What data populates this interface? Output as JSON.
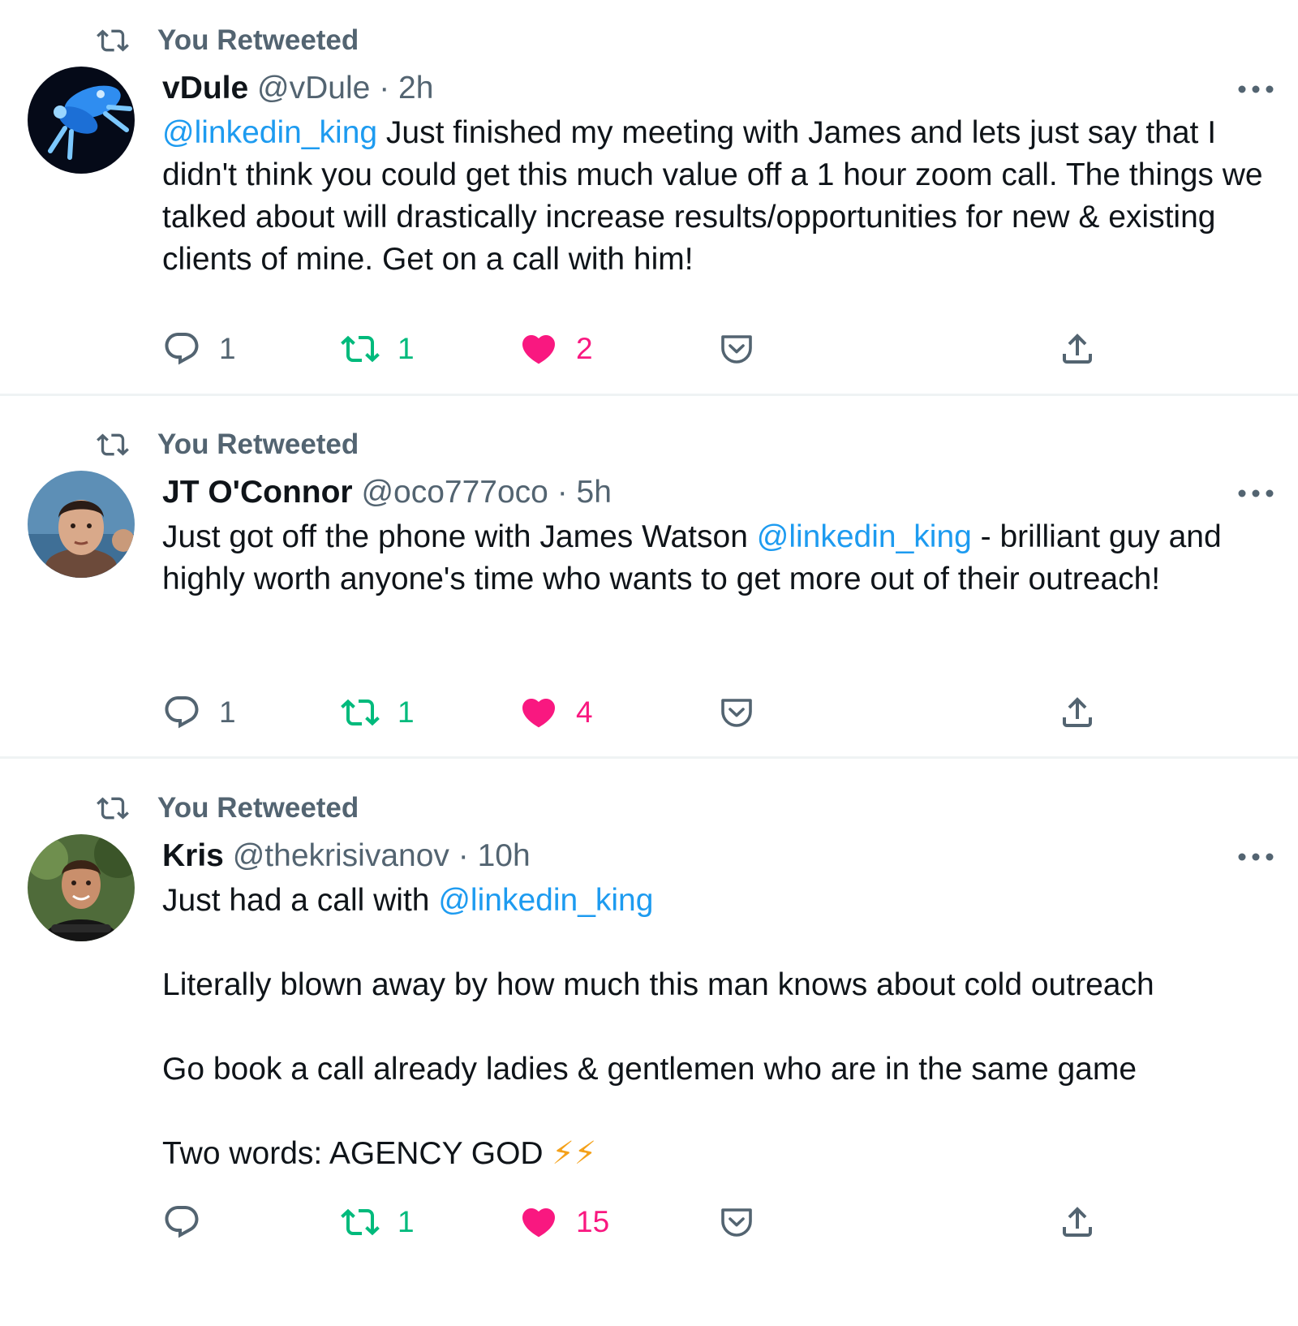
{
  "colors": {
    "mention": "#1d9bf0",
    "retweeted_active": "#00ba7c",
    "liked_active": "#f91880",
    "secondary_text": "#536471"
  },
  "icons": {
    "retweet": "retweet-icon",
    "reply": "reply-icon",
    "like": "heart-icon",
    "save": "pocket-icon",
    "share": "share-icon",
    "more": "more-icon"
  },
  "tweets": [
    {
      "retweet_label": "You Retweeted",
      "name": "vDule",
      "handle": "@vDule",
      "separator": "·",
      "time": "2h",
      "mention": "@linkedin_king",
      "text_after_mention": " Just finished my meeting with James and lets just say that I didn't think you could get this much value off a 1 hour zoom call. The things we talked about will drastically increase results/opportunities for new & existing clients of mine. Get on a call with him!",
      "reply_count": "1",
      "retweet_count": "1",
      "like_count": "2"
    },
    {
      "retweet_label": "You Retweeted",
      "name": "JT O'Connor",
      "handle": "@oco777oco",
      "separator": "·",
      "time": "5h",
      "text_before_mention": "Just got off the phone with James Watson ",
      "mention": "@linkedin_king",
      "text_after_mention": " - brilliant guy and highly worth anyone's time who wants to get more out of their outreach!",
      "reply_count": "1",
      "retweet_count": "1",
      "like_count": "4"
    },
    {
      "retweet_label": "You Retweeted",
      "name": "Kris",
      "handle": "@thekrisivanov",
      "separator": "·",
      "time": "10h",
      "line1_before_mention": "Just had a call with ",
      "mention": "@linkedin_king",
      "line2": "Literally blown away by how much this man knows about cold outreach",
      "line3": "Go book a call already ladies & gentlemen who are in the same game",
      "line4": "Two words: AGENCY GOD ",
      "emoji": "⚡⚡",
      "retweet_count": "1",
      "like_count": "15"
    }
  ]
}
